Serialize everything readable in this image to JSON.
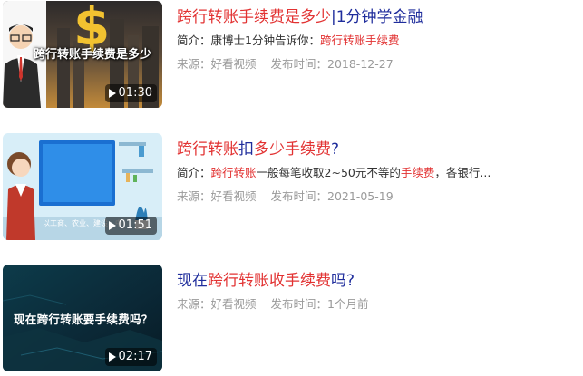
{
  "results": [
    {
      "title_parts": [
        {
          "text": "跨行转账手续费是多少",
          "hl": true
        },
        {
          "text": "|1分钟学金融",
          "hl": false
        }
      ],
      "desc_parts": [
        {
          "text": "简介：康博士1分钟告诉你：",
          "hl": false
        },
        {
          "text": "跨行转账手续费",
          "hl": true
        }
      ],
      "source": "来源：好看视频",
      "published": "发布时间：2018-12-27",
      "duration": "01:30",
      "thumb_caption": "跨行转账手续费是多少"
    },
    {
      "title_parts": [
        {
          "text": "跨行转账",
          "hl": true
        },
        {
          "text": "扣",
          "hl": false
        },
        {
          "text": "多少手续费",
          "hl": true
        },
        {
          "text": "?",
          "hl": false
        }
      ],
      "desc_parts": [
        {
          "text": "简介：",
          "hl": false
        },
        {
          "text": "跨行转账",
          "hl": true
        },
        {
          "text": "一般每笔收取2~50元不等的",
          "hl": false
        },
        {
          "text": "手续费",
          "hl": true
        },
        {
          "text": "，各银行...",
          "hl": false
        }
      ],
      "source": "来源：好看视频",
      "published": "发布时间：2021-05-19",
      "duration": "01:51",
      "thumb_caption": "以工商、农业、建设、中"
    },
    {
      "title_parts": [
        {
          "text": "现在",
          "hl": false
        },
        {
          "text": "跨行转账收手续费",
          "hl": true
        },
        {
          "text": "吗?",
          "hl": false
        }
      ],
      "desc_parts": [],
      "source": "来源：好看视频",
      "published": "发布时间：1个月前",
      "duration": "02:17",
      "thumb_caption": "现在跨行转账要手续费吗？"
    }
  ],
  "colors": {
    "title": "#1f2d9c",
    "highlight": "#e23232",
    "meta": "#9a9a9a"
  }
}
